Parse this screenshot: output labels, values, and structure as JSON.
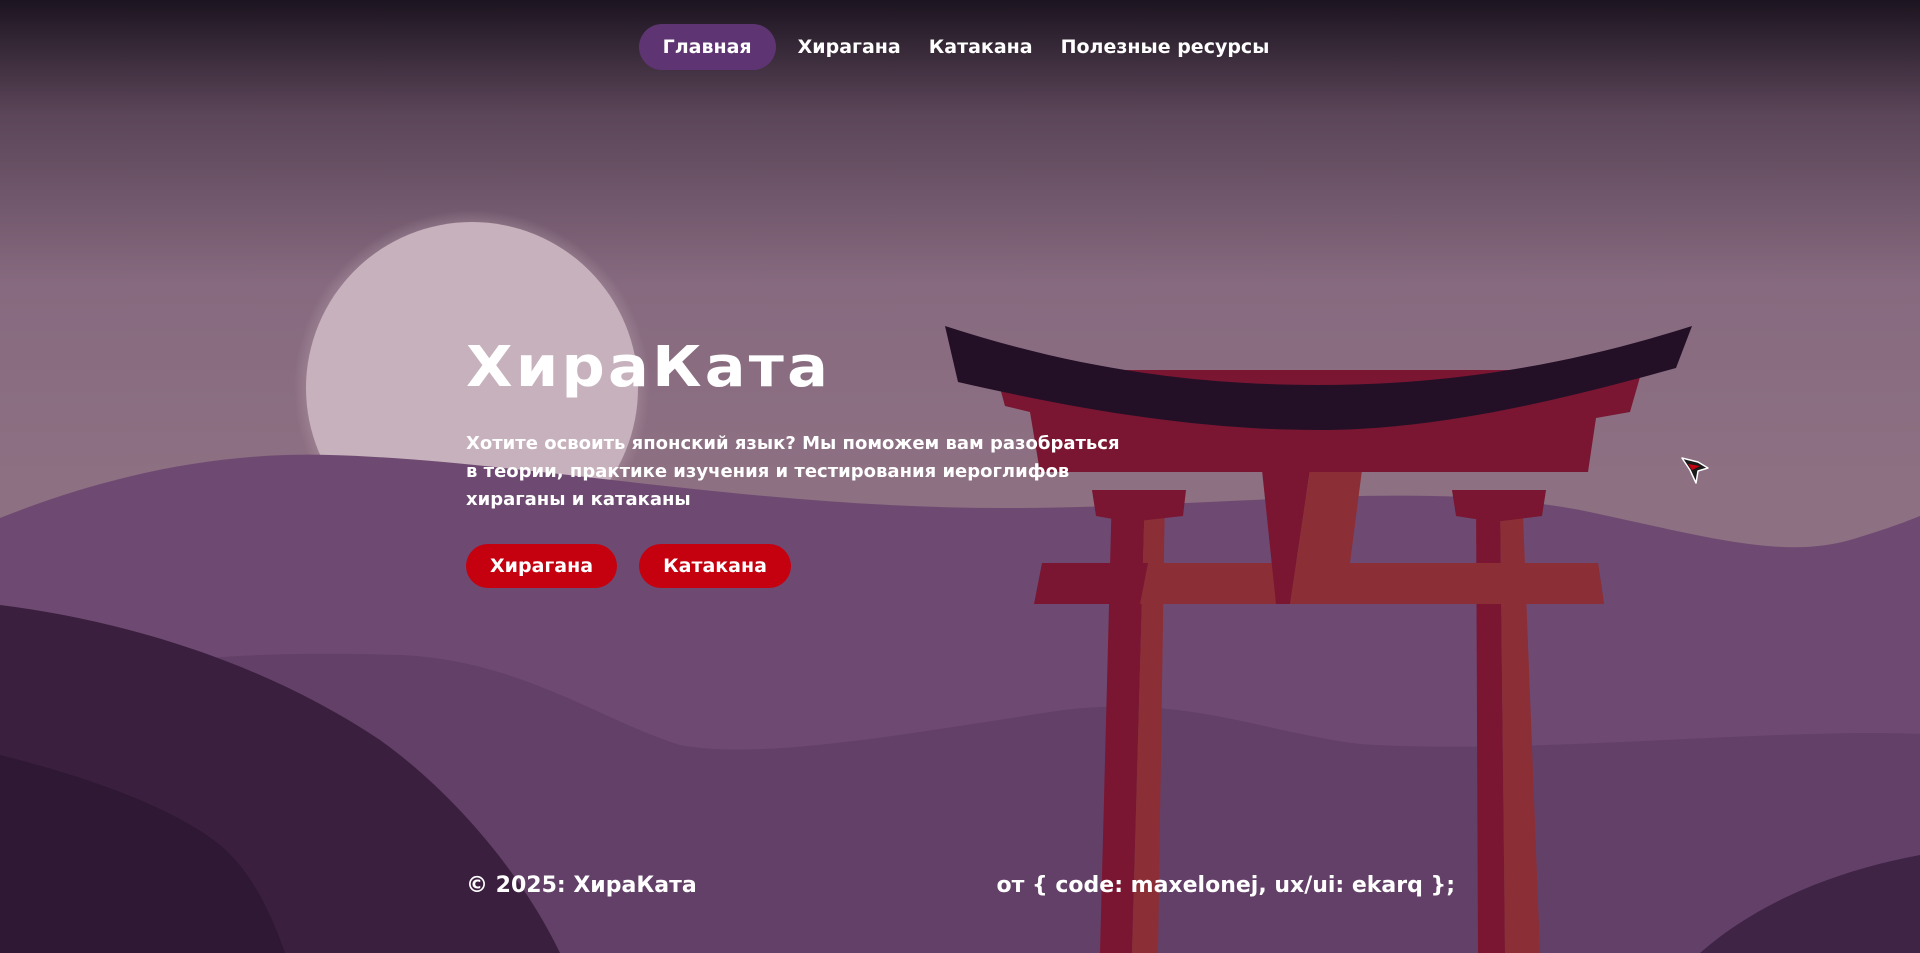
{
  "nav": {
    "items": [
      {
        "label": "Главная",
        "active": true
      },
      {
        "label": "Хирагана",
        "active": false
      },
      {
        "label": "Катакана",
        "active": false
      },
      {
        "label": "Полезные ресурсы",
        "active": false
      }
    ]
  },
  "hero": {
    "title": "ХираКата",
    "description": "Хотите освоить японский язык? Мы поможем вам разобраться в теории, практике изучения и тестирования иероглифов хираганы и катаканы",
    "buttons": {
      "hiragana": "Хирагана",
      "katakana": "Катакана"
    }
  },
  "footer": {
    "copyright": "© 2025: ХираКата",
    "credits": "от { code: maxelonej, ux/ui: ekarq };"
  },
  "colors": {
    "accent_red": "#c5000f",
    "nav_active": "#5e3572",
    "torii_red": "#7a1631",
    "torii_roof": "#231027"
  },
  "icons": {
    "cursor": "ninja-star-cursor-icon"
  }
}
